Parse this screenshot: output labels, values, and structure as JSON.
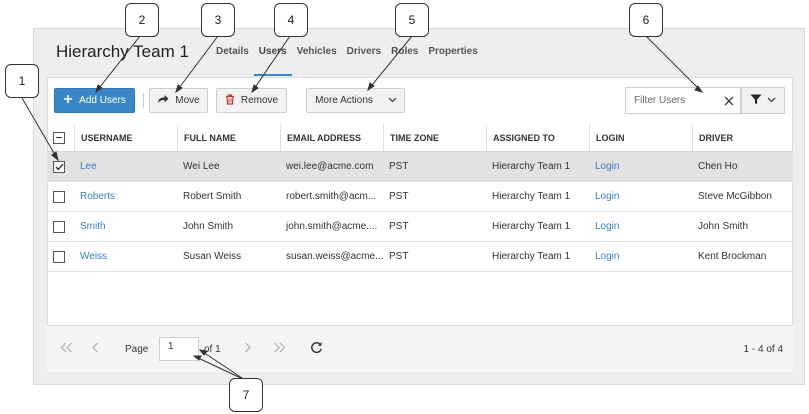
{
  "header": {
    "title": "Hierarchy Team 1"
  },
  "tabs": [
    {
      "label": "Details"
    },
    {
      "label": "Users"
    },
    {
      "label": "Vehicles"
    },
    {
      "label": "Drivers"
    },
    {
      "label": "Roles"
    },
    {
      "label": "Properties"
    }
  ],
  "active_tab": "Users",
  "toolbar": {
    "add_users": "Add Users",
    "move": "Move",
    "remove": "Remove",
    "more_actions": "More Actions"
  },
  "filter": {
    "placeholder": "Filter Users",
    "value": ""
  },
  "table": {
    "columns": [
      "USERNAME",
      "FULL NAME",
      "EMAIL ADDRESS",
      "TIME ZONE",
      "ASSIGNED TO",
      "LOGIN",
      "DRIVER"
    ],
    "rows": [
      {
        "username": "Lee",
        "full_name": "Wei Lee",
        "email": "wei.lee@acme.com",
        "time_zone": "PST",
        "assigned_to": "Hierarchy Team 1",
        "login": "Login",
        "driver": "Chen Ho",
        "checked": true
      },
      {
        "username": "Roberts",
        "full_name": "Robert Smith",
        "email": "robert.smith@acm...",
        "time_zone": "PST",
        "assigned_to": "Hierarchy Team 1",
        "login": "Login",
        "driver": "Steve McGibbon",
        "checked": false
      },
      {
        "username": "Smith",
        "full_name": "John Smith",
        "email": "john.smith@acme....",
        "time_zone": "PST",
        "assigned_to": "Hierarchy Team 1",
        "login": "Login",
        "driver": "John Smith",
        "checked": false
      },
      {
        "username": "Weiss",
        "full_name": "Susan Weiss",
        "email": "susan.weiss@acme...",
        "time_zone": "PST",
        "assigned_to": "Hierarchy Team 1",
        "login": "Login",
        "driver": "Kent Brockman",
        "checked": false
      }
    ]
  },
  "pager": {
    "page_label": "Page",
    "page_value": "1",
    "of_label": "of 1",
    "count_label": "1 - 4 of 4"
  },
  "callouts": [
    "1",
    "2",
    "3",
    "4",
    "5",
    "6",
    "7"
  ],
  "colors": {
    "accent": "#3a87c8",
    "link": "#3a7fc2",
    "panel": "#eeeeee",
    "selected_row": "#e2e2e2",
    "callout_line": "#333333"
  },
  "icons": {
    "add_users": "plus-icon",
    "move": "share-arrow-icon",
    "remove": "trash-icon",
    "more_actions": "chevron-down-icon",
    "filter_clear": "close-icon",
    "filter_button": "funnel-icon",
    "pager": [
      "first-page-icon",
      "previous-page-icon",
      "next-page-icon",
      "last-page-icon",
      "refresh-icon"
    ]
  }
}
